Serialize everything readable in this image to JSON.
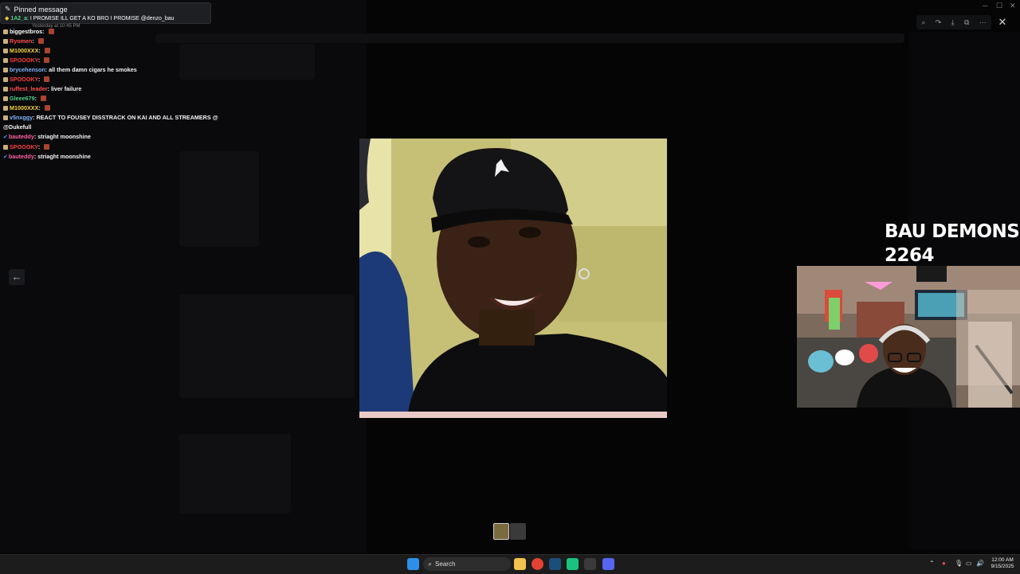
{
  "pinned": {
    "header": "Pinned message",
    "user": "1A2_a",
    "text": "I PROMISE ILL GET A KO BRO I PROMISE @denzo_bau"
  },
  "timestamp": "Yesterday at 10:45 PM",
  "chat": [
    {
      "user": "biggestbros",
      "color": "#ffffff",
      "text": "",
      "emote": true
    },
    {
      "user": "Ryomen",
      "color": "#ff4d4d",
      "text": "",
      "emote": true
    },
    {
      "user": "M1000XXX",
      "color": "#f5d442",
      "text": "",
      "emote": true
    },
    {
      "user": "SPOOOKY",
      "color": "#ff3b3b",
      "text": "",
      "emote": true
    },
    {
      "user": "brycehenson",
      "color": "#7fb2ff",
      "text": "all them damn cigars he smokes",
      "emote": false
    },
    {
      "user": "SPOOOKY",
      "color": "#ff3b3b",
      "text": "",
      "emote": true
    },
    {
      "user": "ruffest_leader",
      "color": "#ff4d4d",
      "text": "liver failure",
      "emote": false
    },
    {
      "user": "Gleee679",
      "color": "#4fd18b",
      "text": "",
      "emote": true
    },
    {
      "user": "M1000XXX",
      "color": "#f5d442",
      "text": "",
      "emote": true
    },
    {
      "user": "v5nxggy",
      "color": "#7fb2ff",
      "text": "REACT TO FOUSEY DISSTRACK ON KAI AND ALL STREAMERS @ydballout",
      "emote": false
    },
    {
      "user": "",
      "color": "#ffffff",
      "text": "@Dukefull",
      "emote": false
    },
    {
      "user": "bauteddy",
      "color": "#ff5fa2",
      "text": "striaght moonshine",
      "emote": false
    },
    {
      "user": "SPOOOKY",
      "color": "#ff3b3b",
      "text": "",
      "emote": true
    },
    {
      "user": "bauteddy",
      "color": "#ff5fa2",
      "text": "striaght moonshine",
      "emote": false
    }
  ],
  "overlay": {
    "line1": "BAU DEMONS",
    "line2": "2264"
  },
  "taskbar": {
    "search_label": "Search",
    "time": "12:00 AM",
    "date": "9/15/2025"
  },
  "icons": {
    "back": "arrow-left-icon",
    "zoom": "zoom-icon",
    "forward": "share-icon",
    "download": "download-icon",
    "open": "open-external-icon",
    "more": "more-icon",
    "close": "close-icon"
  }
}
